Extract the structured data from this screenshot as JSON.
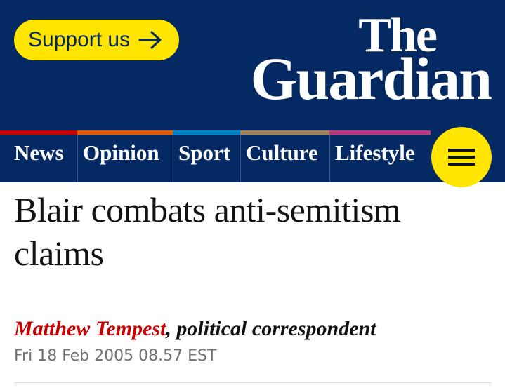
{
  "masthead": {
    "support_label": "Support us",
    "logo_line1": "The",
    "logo_line2": "Guardian",
    "colors": {
      "background": "#052962",
      "support": "#ffe500"
    }
  },
  "nav": {
    "items": [
      {
        "label": "News",
        "color": "#c70000"
      },
      {
        "label": "Opinion",
        "color": "#e05e00"
      },
      {
        "label": "Sport",
        "color": "#0084c6"
      },
      {
        "label": "Culture",
        "color": "#a1845c"
      },
      {
        "label": "Lifestyle",
        "color": "#bb3b80"
      }
    ],
    "menu_icon": "hamburger-icon"
  },
  "article": {
    "headline": "Blair combats anti-semitism claims",
    "author": "Matthew Tempest",
    "author_role": ", political correspondent",
    "date": "Fri 18 Feb 2005 08.57 EST",
    "author_color": "#c70000"
  }
}
